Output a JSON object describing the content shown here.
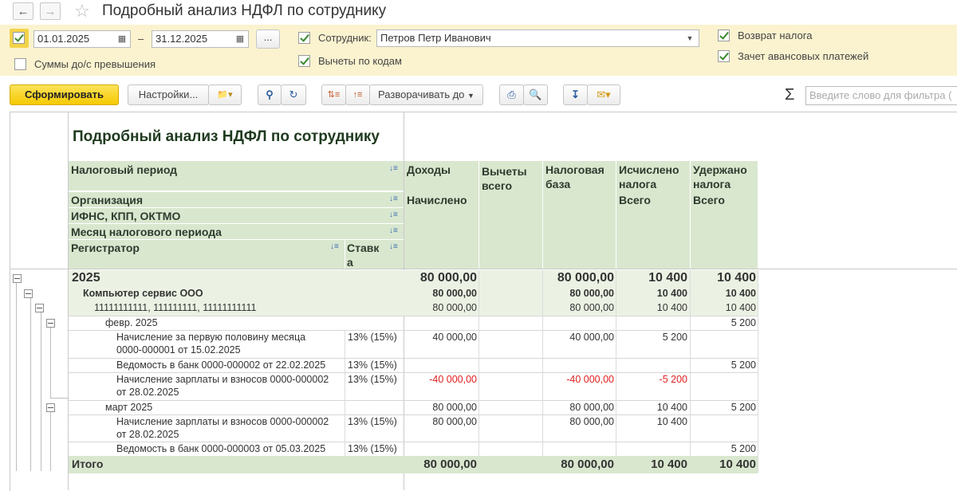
{
  "window": {
    "title": "Подробный анализ НДФЛ по сотруднику"
  },
  "filters": {
    "period_enabled": true,
    "date_from": "01.01.2025",
    "date_separator": "–",
    "date_to": "31.12.2025",
    "more_button": "...",
    "sums_over_label": "Суммы до/с превышения",
    "sums_over_checked": false,
    "employee_checked": true,
    "employee_label": "Сотрудник:",
    "employee_value": "Петров Петр Иванович",
    "deductions_label": "Вычеты по кодам",
    "deductions_checked": true,
    "refund_label": "Возврат налога",
    "refund_checked": true,
    "advance_label": "Зачет авансовых платежей",
    "advance_checked": true
  },
  "toolbar": {
    "generate_label": "Сформировать",
    "settings_label": "Настройки...",
    "expand_label": "Разворачивать до",
    "search_placeholder": "Введите слово для фильтра (",
    "sum_symbol": "Σ"
  },
  "report": {
    "title": "Подробный анализ НДФЛ по сотруднику",
    "headers": {
      "period": "Налоговый период",
      "organization": "Организация",
      "ifns": "ИФНС, КПП, ОКТМО",
      "month": "Месяц налогового периода",
      "registrar": "Регистратор",
      "rate": "Ставка",
      "income": "Доходы",
      "income_sub": "Начислено",
      "deductions": "Вычеты всего",
      "base": "Налоговая база",
      "calculated": "Исчислено налога",
      "calculated_sub": "Всего",
      "withheld": "Удержано налога",
      "withheld_sub": "Всего"
    },
    "rows": [
      {
        "label": "2025",
        "rate": "",
        "income": "80 000,00",
        "ded": "",
        "base": "80 000,00",
        "calc": "10 400",
        "held": "10 400"
      },
      {
        "label": "Компьютер сервис ООО",
        "rate": "",
        "income": "80 000,00",
        "ded": "",
        "base": "80 000,00",
        "calc": "10 400",
        "held": "10 400"
      },
      {
        "label": "11111111111, 111111111, 11111111111",
        "rate": "",
        "income": "80 000,00",
        "ded": "",
        "base": "80 000,00",
        "calc": "10 400",
        "held": "10 400"
      },
      {
        "label": "февр. 2025",
        "rate": "",
        "income": "",
        "ded": "",
        "base": "",
        "calc": "",
        "held": "5 200"
      },
      {
        "label": "Начисление за первую половину месяца",
        "label2": "0000-000001 от 15.02.2025",
        "rate": "13% (15%)",
        "income": "40 000,00",
        "ded": "",
        "base": "40 000,00",
        "calc": "5 200",
        "held": ""
      },
      {
        "label": "Ведомость в банк 0000-000002 от 22.02.2025",
        "rate": "13% (15%)",
        "income": "",
        "ded": "",
        "base": "",
        "calc": "",
        "held": "5 200"
      },
      {
        "label": "Начисление зарплаты и взносов 0000-000002",
        "label2": "от 28.02.2025",
        "rate": "13% (15%)",
        "income": "-40 000,00",
        "ded": "",
        "base": "-40 000,00",
        "calc": "-5 200",
        "held": ""
      },
      {
        "label": "март 2025",
        "rate": "",
        "income": "80 000,00",
        "ded": "",
        "base": "80 000,00",
        "calc": "10 400",
        "held": "5 200"
      },
      {
        "label": "Начисление зарплаты и взносов 0000-000002",
        "label2": "от 28.02.2025",
        "rate": "13% (15%)",
        "income": "80 000,00",
        "ded": "",
        "base": "80 000,00",
        "calc": "10 400",
        "held": ""
      },
      {
        "label": "Ведомость в банк 0000-000003 от 05.03.2025",
        "rate": "13% (15%)",
        "income": "",
        "ded": "",
        "base": "",
        "calc": "",
        "held": "5 200"
      }
    ],
    "total": {
      "label": "Итого",
      "income": "80 000,00",
      "ded": "",
      "base": "80 000,00",
      "calc": "10 400",
      "held": "10 400"
    }
  }
}
